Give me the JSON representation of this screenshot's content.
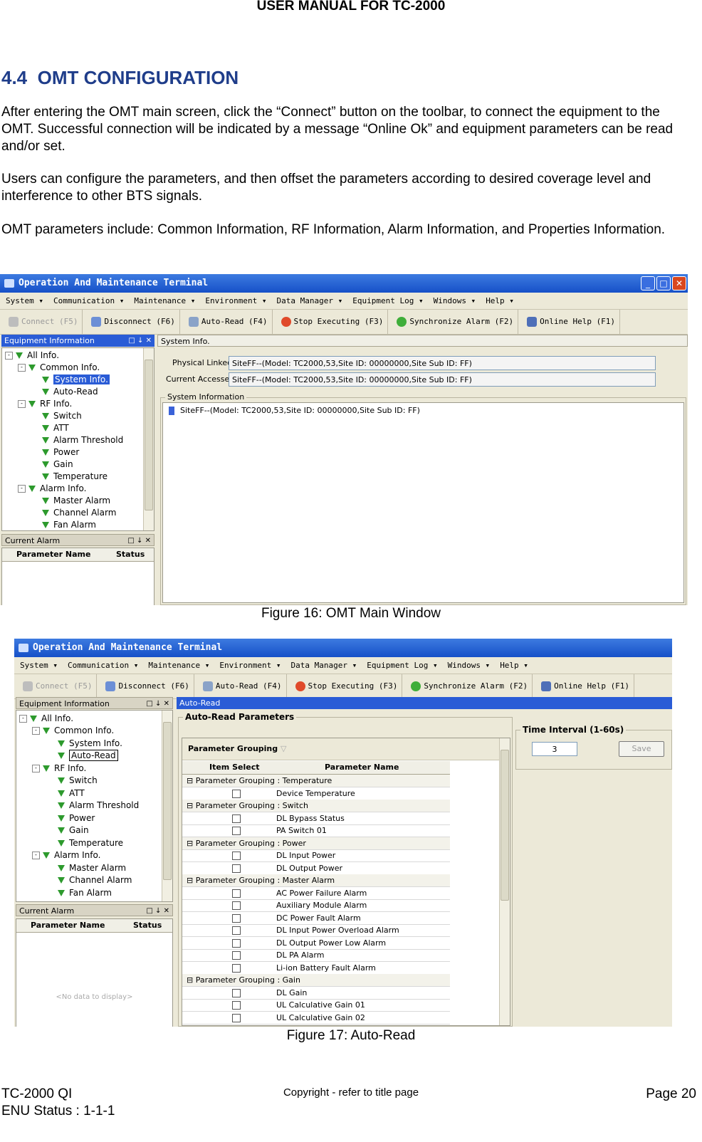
{
  "header": {
    "title": "USER MANUAL FOR TC-2000"
  },
  "section": {
    "number": "4.4",
    "title": "OMT CONFIGURATION"
  },
  "paragraphs": [
    "After entering the OMT main screen, click the “Connect” button on the toolbar, to connect the equipment to the OMT. Successful connection will be indicated by a message “Online Ok” and equipment parameters can be read and/or set.",
    "Users can configure the parameters, and then offset the parameters according to desired coverage level and interference to other BTS signals.",
    "OMT parameters include: Common Information, RF Information, Alarm Information, and Properties Information."
  ],
  "app": {
    "title": "Operation And Maintenance Terminal",
    "menu": [
      "System ▾",
      "Communication ▾",
      "Maintenance ▾",
      "Environment ▾",
      "Data Manager ▾",
      "Equipment Log ▾",
      "Windows ▾",
      "Help ▾"
    ],
    "toolbar": {
      "connect": "Connect (F5)",
      "disconnect": "Disconnect (F6)",
      "auto_read": "Auto-Read (F4)",
      "stop": "Stop Executing (F3)",
      "sync": "Synchronize Alarm (F2)",
      "help": "Online Help (F1)"
    },
    "equipment_pane": "Equipment Information",
    "pane_buttons": "□ ↓ ✕",
    "tree": {
      "all": "All Info.",
      "common": "Common Info.",
      "system": "System Info.",
      "autoread": "Auto-Read",
      "rf": "RF Info.",
      "switch": "Switch",
      "att": "ATT",
      "alarm_threshold": "Alarm Threshold",
      "power": "Power",
      "gain": "Gain",
      "temperature": "Temperature",
      "alarm": "Alarm Info.",
      "master": "Master Alarm",
      "channel": "Channel Alarm",
      "fan": "Fan Alarm"
    },
    "current_alarm": {
      "title": "Current Alarm",
      "col_param": "Parameter Name",
      "col_status": "Status",
      "empty": "<No data to display>"
    }
  },
  "fig16": {
    "tab": "System Info.",
    "physical_label": "Physical Linked",
    "physical_value": "SiteFF--(Model: TC2000,53,Site ID: 00000000,Site Sub ID: FF)",
    "current_label": "Current Accessed",
    "current_value": "SiteFF--(Model: TC2000,53,Site ID: 00000000,Site Sub ID: FF)",
    "sysinfo_group": "System Information",
    "sysinfo_node": "SiteFF--(Model: TC2000,53,Site ID: 00000000,Site Sub ID: FF)",
    "caption": "Figure 16: OMT Main Window"
  },
  "fig17": {
    "tab": "Auto-Read",
    "group": "Auto-Read Parameters",
    "grouping": "Parameter Grouping",
    "col_item": "Item Select",
    "col_param": "Parameter Name",
    "rows": [
      {
        "group": "Parameter Grouping : Temperature"
      },
      {
        "name": "Device Temperature"
      },
      {
        "group": "Parameter Grouping : Switch"
      },
      {
        "name": "DL Bypass Status"
      },
      {
        "name": "PA Switch 01"
      },
      {
        "group": "Parameter Grouping : Power"
      },
      {
        "name": "DL Input Power"
      },
      {
        "name": "DL Output Power"
      },
      {
        "group": "Parameter Grouping : Master Alarm"
      },
      {
        "name": "AC Power Failure Alarm"
      },
      {
        "name": "Auxiliary Module Alarm"
      },
      {
        "name": "DC Power Fault Alarm"
      },
      {
        "name": "DL Input Power Overload Alarm"
      },
      {
        "name": "DL Output Power Low Alarm"
      },
      {
        "name": "DL PA Alarm"
      },
      {
        "name": "Li-ion Battery Fault Alarm"
      },
      {
        "group": "Parameter Grouping : Gain"
      },
      {
        "name": "DL Gain"
      },
      {
        "name": "UL Calculative Gain 01"
      },
      {
        "name": "UL Calculative Gain 02"
      }
    ],
    "interval_group": "Time Interval (1-60s)",
    "interval_value": "3",
    "save": "Save",
    "caption": "Figure 17: Auto-Read"
  },
  "footer": {
    "left1": "TC-2000 QI",
    "left2": "ENU Status : 1-1-1",
    "center": "Copyright - refer to title page",
    "page": "Page 20"
  },
  "colors": {
    "heading": "#1f3d8a",
    "titlebar": "#1650c8",
    "folder_icon": "#2d9a2d"
  }
}
